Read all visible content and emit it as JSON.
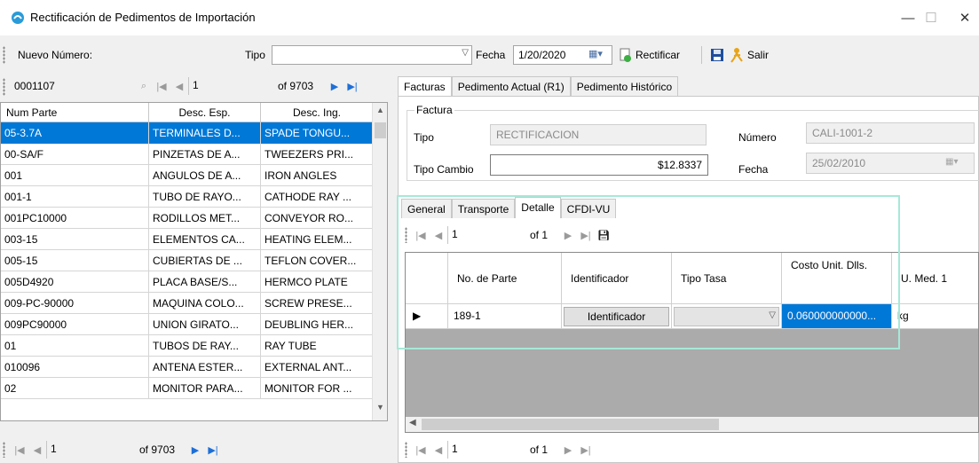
{
  "window": {
    "title": "Rectificación de Pedimentos de Importación",
    "controls": {
      "minimize": "—",
      "maximize": "☐",
      "close": "✕"
    }
  },
  "toolbar": {
    "nuevo_numero_label": "Nuevo Número:",
    "tipo_label": "Tipo",
    "tipo_value": "",
    "fecha_label": "Fecha",
    "fecha_value": "1/20/2020",
    "rectificar_label": "Rectificar",
    "salir_label": "Salir"
  },
  "search": {
    "value": "0001107",
    "position": "1",
    "of_total": "of 9703"
  },
  "grid": {
    "columns": [
      "Num Parte",
      "Desc. Esp.",
      "Desc. Ing."
    ],
    "rows": [
      [
        "05-3.7A",
        "TERMINALES D...",
        "SPADE TONGU..."
      ],
      [
        "00-SA/F",
        "PINZETAS DE A...",
        "TWEEZERS PRI..."
      ],
      [
        "001",
        "ANGULOS DE A...",
        "IRON ANGLES"
      ],
      [
        "001-1",
        "TUBO DE RAYO...",
        "CATHODE RAY ..."
      ],
      [
        "001PC10000",
        "RODILLOS MET...",
        "CONVEYOR RO..."
      ],
      [
        "003-15",
        "ELEMENTOS CA...",
        "HEATING ELEM..."
      ],
      [
        "005-15",
        "CUBIERTAS DE ...",
        "TEFLON COVER..."
      ],
      [
        "005D4920",
        "PLACA BASE/S...",
        "HERMCO PLATE"
      ],
      [
        "009-PC-90000",
        "MAQUINA COLO...",
        "SCREW PRESE..."
      ],
      [
        "009PC90000",
        "UNION GIRATO...",
        "DEUBLING HER..."
      ],
      [
        "01",
        "TUBOS DE RAY...",
        "RAY TUBE"
      ],
      [
        "010096",
        "ANTENA ESTER...",
        "EXTERNAL ANT..."
      ],
      [
        "02",
        "MONITOR PARA...",
        "MONITOR FOR ..."
      ]
    ],
    "selected_row": 0
  },
  "bottom_nav": {
    "position": "1",
    "of_total": "of 9703"
  },
  "tabs": [
    "Facturas",
    "Pedimento Actual (R1)",
    "Pedimento Histórico"
  ],
  "factura": {
    "legend": "Factura",
    "tipo_label": "Tipo",
    "tipo_value": "RECTIFICACION",
    "numero_label": "Número",
    "numero_value": "CALI-1001-2",
    "tipo_cambio_label": "Tipo Cambio",
    "tipo_cambio_value": "$12.8337",
    "fecha_label": "Fecha",
    "fecha_value": "25/02/2010"
  },
  "detail_tabs": [
    "General",
    "Transporte",
    "Detalle",
    "CFDI-VU"
  ],
  "detail_nav": {
    "position": "1",
    "of_total": "of 1"
  },
  "detail_grid": {
    "columns": [
      "No. de Parte",
      "Identificador",
      "Tipo Tasa",
      "Costo Unit. Dlls.",
      "U. Med. 1"
    ],
    "row": {
      "no_parte": "189-1",
      "identificador": "Identificador",
      "tipo_tasa": "",
      "costo_unit": "0.060000000000...",
      "u_med": "kg"
    }
  },
  "detail_bottom_nav": {
    "position": "1",
    "of_total": "of 1"
  },
  "colors": {
    "selection": "#0078d7",
    "nav_enabled": "#1d6fd8",
    "focus_outline": "#a7e8d8"
  }
}
